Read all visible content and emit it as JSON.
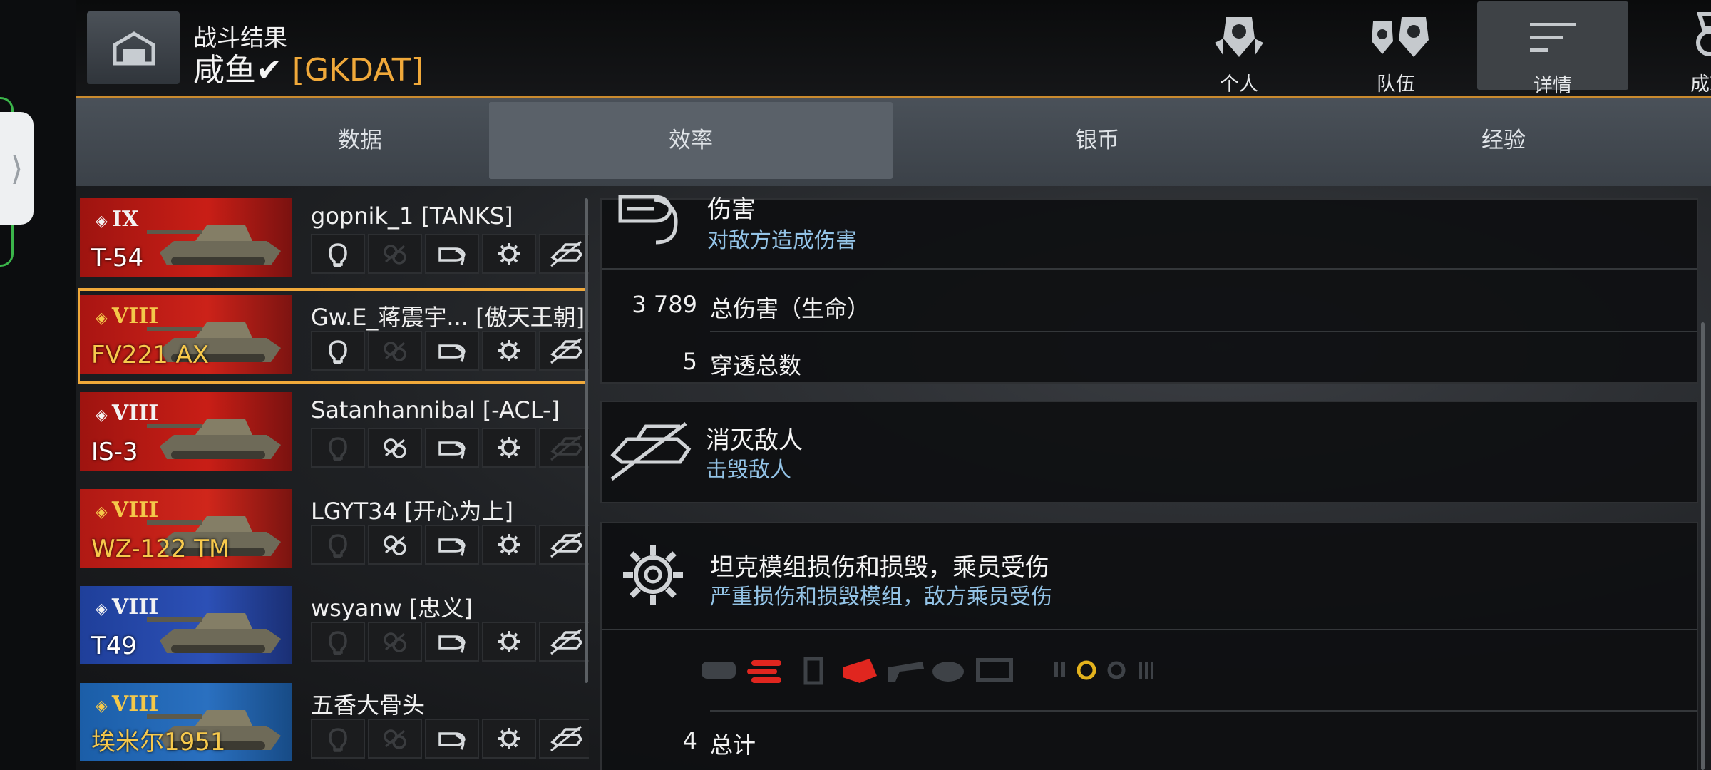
{
  "header": {
    "battle_title": "战斗结果",
    "player_name": "咸鱼✔",
    "player_clan": "[GKDAT]",
    "tabs": [
      {
        "label": "个人",
        "icon": "personal-icon"
      },
      {
        "label": "队伍",
        "icon": "team-icon"
      },
      {
        "label": "详情",
        "icon": "details-icon",
        "active": true
      },
      {
        "label": "成就",
        "icon": "achievement-medal-icon"
      }
    ]
  },
  "subtabs": [
    {
      "label": "数据"
    },
    {
      "label": "效率",
      "active": true
    },
    {
      "label": "银币"
    },
    {
      "label": "经验"
    }
  ],
  "players": [
    {
      "tier": "IX",
      "tank": "T-54",
      "name": "gopnik_1 [TANKS]",
      "flag": "ussr",
      "tank_gold": false,
      "tier_gold": false,
      "icons": [
        true,
        false,
        true,
        true,
        true
      ]
    },
    {
      "tier": "VIII",
      "tank": "FV221 AX",
      "name": "Gw.E_蒋震宇...  [傲天王朝]",
      "flag": "uk",
      "tank_gold": true,
      "tier_gold": true,
      "selected": true,
      "icons": [
        true,
        false,
        true,
        true,
        true
      ]
    },
    {
      "tier": "VIII",
      "tank": "IS-3",
      "name": "Satanhannibal [-ACL-]",
      "flag": "ussr",
      "tank_gold": false,
      "tier_gold": false,
      "icons": [
        false,
        true,
        true,
        true,
        false
      ]
    },
    {
      "tier": "VIII",
      "tank": "WZ-122 TM",
      "name": "LGYT34 [开心为上]",
      "flag": "china",
      "tank_gold": true,
      "tier_gold": true,
      "icons": [
        false,
        true,
        true,
        true,
        true
      ]
    },
    {
      "tier": "VIII",
      "tank": "T49",
      "name": "wsyanw [忠义]",
      "flag": "usa",
      "tank_gold": false,
      "tier_gold": false,
      "icons": [
        false,
        false,
        true,
        true,
        true
      ]
    },
    {
      "tier": "VIII",
      "tank": "埃米尔1951",
      "name": "五香大骨头",
      "flag": "sweden",
      "tank_gold": true,
      "tier_gold": true,
      "icons": [
        false,
        false,
        true,
        true,
        true
      ]
    }
  ],
  "damage_card": {
    "title": "伤害",
    "subtitle": "对敌方造成伤害",
    "stats": [
      {
        "value": "3 789",
        "label": "总伤害（生命）"
      },
      {
        "value": "5",
        "label": "穿透总数"
      }
    ]
  },
  "kill_card": {
    "title": "消灭敌人",
    "subtitle": "击毁敌人"
  },
  "module_card": {
    "title": "坦克模组损伤和损毁，乘员受伤",
    "subtitle": "严重损伤和损毁模组，敌方乘员受伤",
    "total_value": "4",
    "total_label": "总计",
    "accent_red": "#e0261f",
    "accent_yellow": "#e3b21d"
  },
  "colors": {
    "accent": "#f0a93a",
    "subtitle_blue": "#93c3e6"
  }
}
